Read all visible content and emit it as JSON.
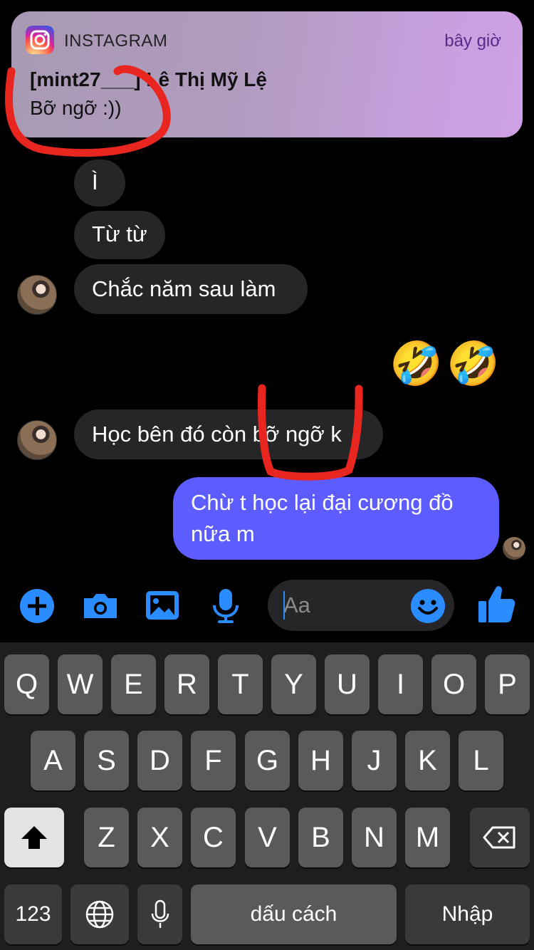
{
  "notification": {
    "app_name": "INSTAGRAM",
    "time": "bây giờ",
    "title": "[mint27___] Lê Thị Mỹ Lệ",
    "body": "Bỡ ngỡ :))"
  },
  "messages": [
    {
      "text": "Ì",
      "from": "other"
    },
    {
      "text": "Từ từ",
      "from": "other"
    },
    {
      "text": "Chắc năm sau làm",
      "from": "other"
    },
    {
      "text": "🤣",
      "from": "me"
    },
    {
      "text": "🤣",
      "from": "me"
    },
    {
      "text": "Học bên đó còn bỡ ngỡ k",
      "from": "other"
    },
    {
      "text": "Chừ t học lại đại cương đồ nữa m",
      "from": "me"
    }
  ],
  "composer": {
    "placeholder": "Aa",
    "value": ""
  },
  "keyboard": {
    "row1": [
      "Q",
      "W",
      "E",
      "R",
      "T",
      "Y",
      "U",
      "I",
      "O",
      "P"
    ],
    "row2": [
      "A",
      "S",
      "D",
      "F",
      "G",
      "H",
      "J",
      "K",
      "L"
    ],
    "row3": [
      "Z",
      "X",
      "C",
      "V",
      "B",
      "N",
      "M"
    ],
    "numbers_label": "123",
    "space_label": "dấu cách",
    "return_label": "Nhập"
  },
  "colors": {
    "my_bubble": "#5c5cff",
    "their_bubble": "#262628",
    "accent_blue": "#2b8cff",
    "annotation_red": "#e8261f"
  },
  "icons": {
    "composer": [
      "plus-circle-icon",
      "camera-icon",
      "image-icon",
      "microphone-icon",
      "emoji-icon",
      "like-icon"
    ],
    "keyboard": [
      "shift-icon",
      "backspace-icon",
      "globe-icon",
      "dictation-icon"
    ]
  }
}
